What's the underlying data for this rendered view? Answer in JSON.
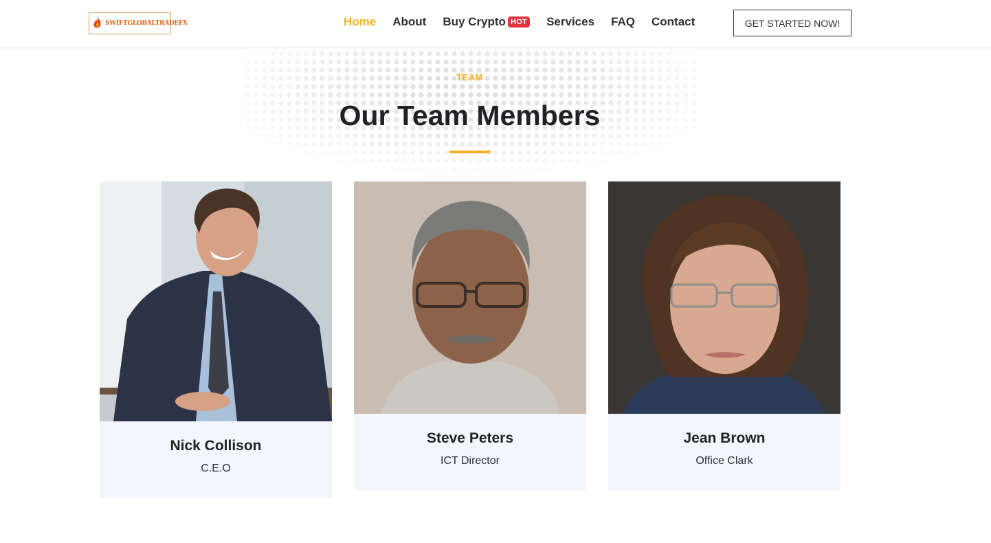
{
  "header": {
    "logo_text": "SWIFTGLOBALTRADEFX",
    "nav": [
      {
        "label": "Home",
        "active": true
      },
      {
        "label": "About",
        "active": false
      },
      {
        "label": "Buy Crypto",
        "active": false,
        "badge": "HOT"
      },
      {
        "label": "Services",
        "active": false
      },
      {
        "label": "FAQ",
        "active": false
      },
      {
        "label": "Contact",
        "active": false
      }
    ],
    "cta_label": "GET STARTED NOW!"
  },
  "section": {
    "eyebrow": "TEAM",
    "title": "Our Team Members"
  },
  "team": [
    {
      "name": "Nick Collison",
      "role": "C.E.O"
    },
    {
      "name": "Steve Peters",
      "role": "ICT Director"
    },
    {
      "name": "Jean Brown",
      "role": "Office Clark"
    }
  ],
  "colors": {
    "accent": "#f5b325",
    "badge": "#e2343f",
    "card_bg": "#f3f7fb",
    "heading": "#1f2124"
  }
}
